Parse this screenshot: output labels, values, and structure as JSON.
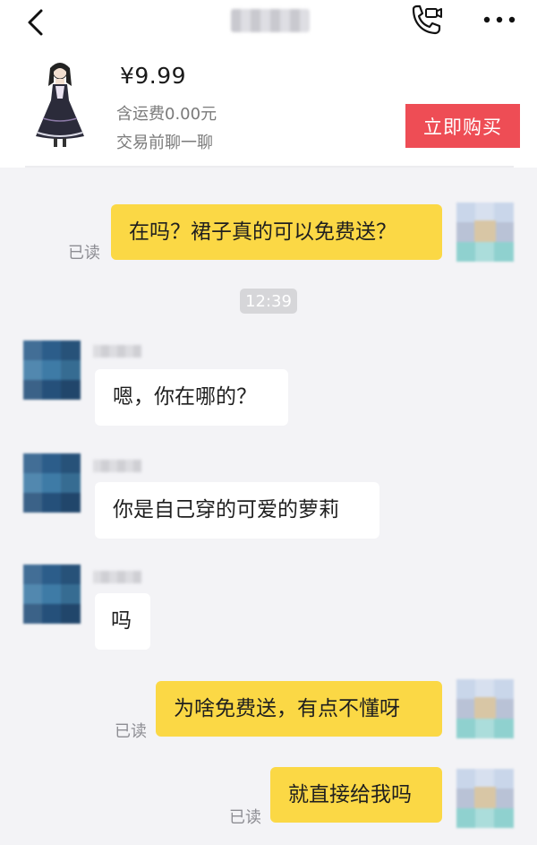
{
  "navbar": {
    "icons": {
      "back": "chevron-left-icon",
      "call": "phone-video-icon",
      "more": "more-icon"
    }
  },
  "product": {
    "price": "¥9.99",
    "shipping": "含运费0.00元",
    "chat_hint": "交易前聊一聊",
    "buy_label": "立即购买",
    "buy_color": "#ee4d55"
  },
  "chat": {
    "read_label": "已读",
    "time_divider": "12:39",
    "messages": [
      {
        "from": "me",
        "text": "在吗？裙子真的可以免费送？"
      },
      {
        "from": "them",
        "text": "嗯，你在哪的？"
      },
      {
        "from": "them",
        "text": "你是自己穿的可爱的萝莉"
      },
      {
        "from": "them",
        "text": "吗"
      },
      {
        "from": "me",
        "text": "为啥免费送，有点不懂呀"
      },
      {
        "from": "me",
        "text": "就直接给我吗"
      }
    ],
    "colors": {
      "outgoing_bubble": "#fbd845",
      "incoming_bubble": "#ffffff",
      "background": "#f3f3f6"
    }
  }
}
